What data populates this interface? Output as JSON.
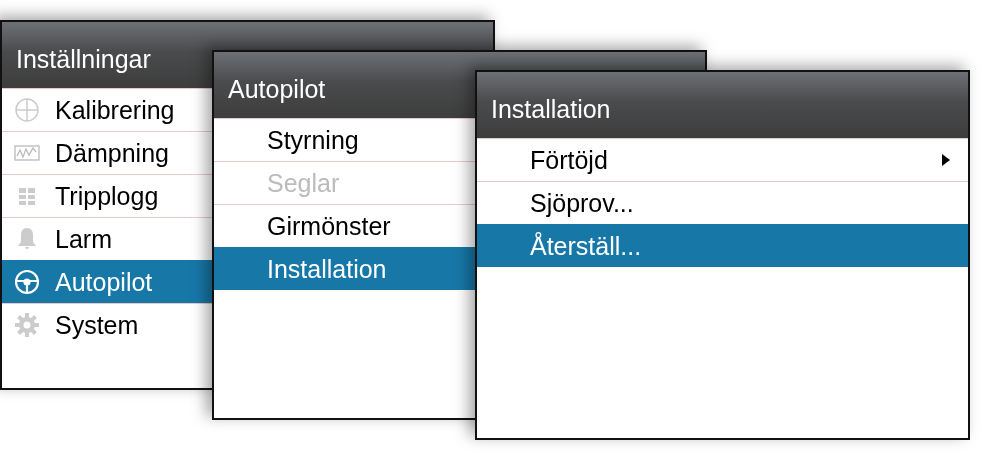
{
  "panels": [
    {
      "title": "Inställningar",
      "items": [
        {
          "label": "Kalibrering",
          "selected": false,
          "disabled": false
        },
        {
          "label": "Dämpning",
          "selected": false,
          "disabled": false
        },
        {
          "label": "Tripplogg",
          "selected": false,
          "disabled": false
        },
        {
          "label": "Larm",
          "selected": false,
          "disabled": false
        },
        {
          "label": "Autopilot",
          "selected": true,
          "disabled": false
        },
        {
          "label": "System",
          "selected": false,
          "disabled": false
        }
      ]
    },
    {
      "title": "Autopilot",
      "items": [
        {
          "label": "Styrning",
          "selected": false,
          "disabled": false
        },
        {
          "label": "Seglar",
          "selected": false,
          "disabled": true
        },
        {
          "label": "Girmönster",
          "selected": false,
          "disabled": false
        },
        {
          "label": "Installation",
          "selected": true,
          "disabled": false
        }
      ]
    },
    {
      "title": "Installation",
      "items": [
        {
          "label": "Förtöjd",
          "selected": false,
          "disabled": false,
          "submenu": true
        },
        {
          "label": "Sjöprov...",
          "selected": false,
          "disabled": false,
          "submenu": false
        },
        {
          "label": "Återställ...",
          "selected": true,
          "disabled": false,
          "submenu": false
        }
      ]
    }
  ]
}
